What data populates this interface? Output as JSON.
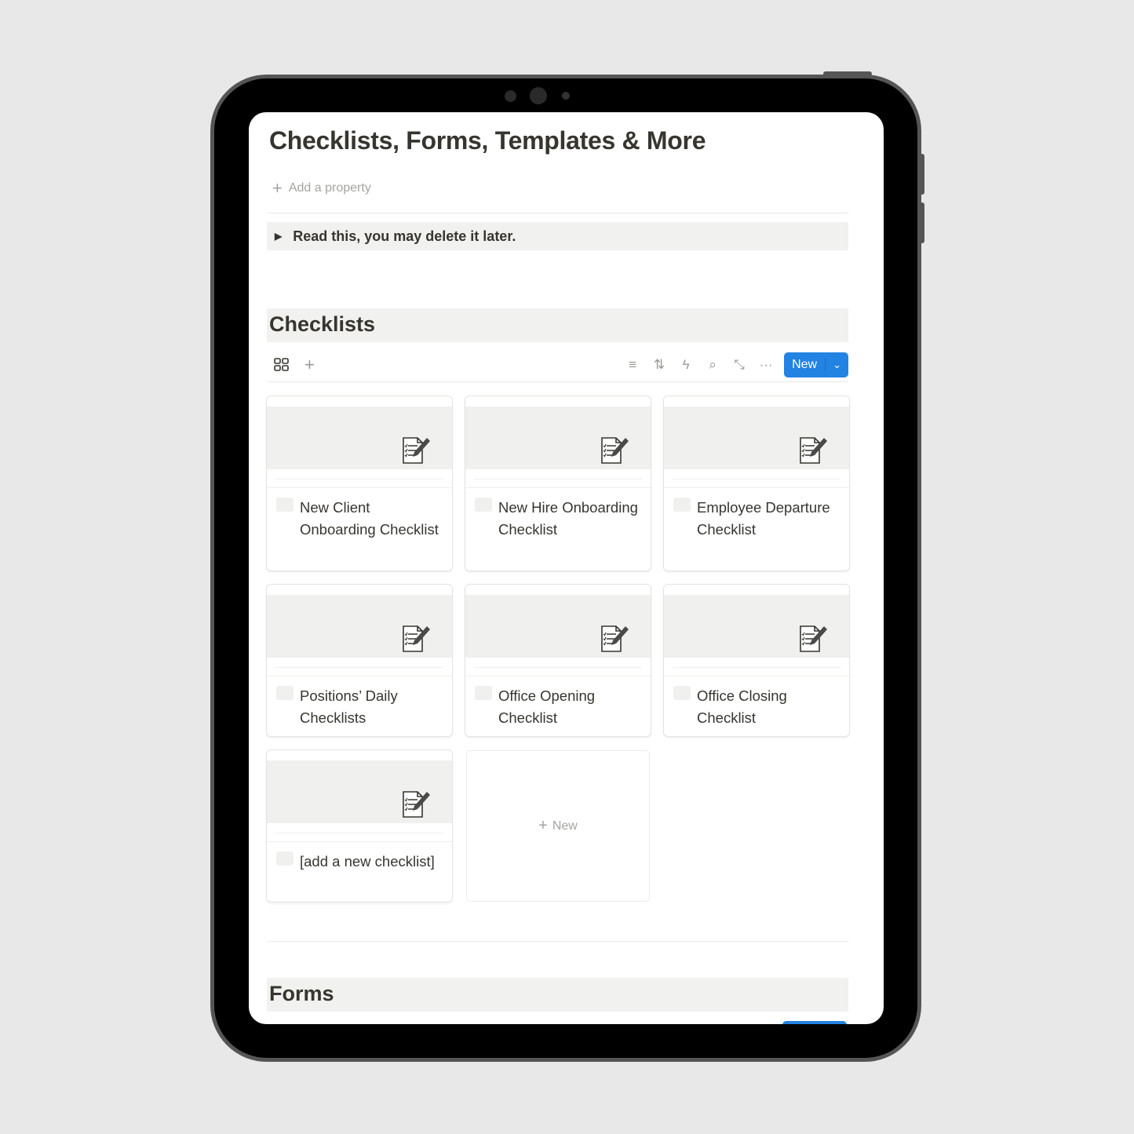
{
  "page": {
    "title": "Checklists, Forms, Templates & More",
    "add_property": "Add a property",
    "toggle_text": "Read this, you may delete it later."
  },
  "checklists": {
    "heading": "Checklists",
    "new_label": "New",
    "cards": [
      {
        "title": "New Client Onboarding Checklist"
      },
      {
        "title": "New Hire Onboarding Checklist"
      },
      {
        "title": "Employee Departure Checklist"
      },
      {
        "title": "Positions’ Daily Checklists"
      },
      {
        "title": "Office Opening Checklist"
      },
      {
        "title": "Office Closing Checklist"
      },
      {
        "title": "[add a new checklist]"
      }
    ],
    "new_card_label": "New"
  },
  "forms": {
    "heading": "Forms"
  },
  "colors": {
    "accent": "#2383e2",
    "cover": "#f0f0ee",
    "text": "#37352f"
  }
}
